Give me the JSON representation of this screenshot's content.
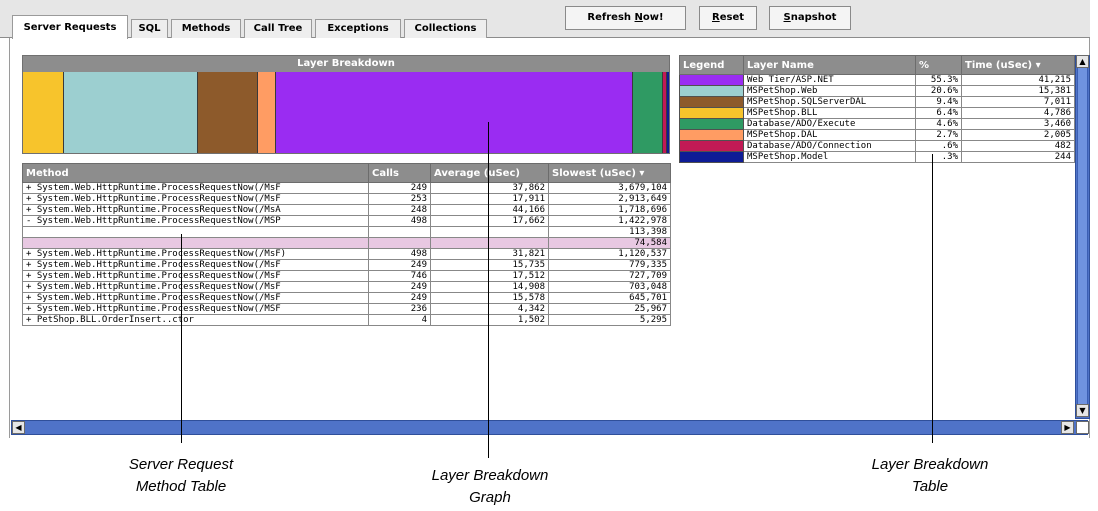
{
  "tabs": [
    {
      "label": "Server Requests",
      "active": true
    },
    {
      "label": "SQL"
    },
    {
      "label": "Methods"
    },
    {
      "label": "Call Tree"
    },
    {
      "label": "Exceptions"
    },
    {
      "label": "Collections"
    }
  ],
  "toolbar": {
    "refresh_prefix": "Refresh ",
    "refresh_ul": "N",
    "refresh_suffix": "ow!",
    "reset_ul": "R",
    "reset_suffix": "eset",
    "snapshot_ul": "S",
    "snapshot_suffix": "napshot"
  },
  "graph": {
    "title": "Layer Breakdown",
    "segments": [
      {
        "color": "#f7c42c",
        "share": 6.4
      },
      {
        "color": "#9ccfd0",
        "share": 20.6
      },
      {
        "color": "#8d5a2b",
        "share": 9.4
      },
      {
        "color": "#ff9c63",
        "share": 2.7
      },
      {
        "color": "#9a2cf2",
        "share": 55.3
      },
      {
        "color": "#2f9a63",
        "share": 4.6
      },
      {
        "color": "#c21a55",
        "share": 0.6
      },
      {
        "color": "#0e1c96",
        "share": 0.3
      }
    ]
  },
  "method_table": {
    "headers": [
      "Method",
      "Calls",
      "Average (uSec)",
      "Slowest (uSec) ▾"
    ],
    "rows": [
      {
        "method": "+ System.Web.HttpRuntime.ProcessRequestNow(/MsF",
        "calls": "249",
        "avg": "37,862",
        "slowest": "3,679,104"
      },
      {
        "method": "+ System.Web.HttpRuntime.ProcessRequestNow(/MsF",
        "calls": "253",
        "avg": "17,911",
        "slowest": "2,913,649"
      },
      {
        "method": "+ System.Web.HttpRuntime.ProcessRequestNow(/MsA",
        "calls": "248",
        "avg": "44,166",
        "slowest": "1,718,696"
      },
      {
        "method": "- System.Web.HttpRuntime.ProcessRequestNow(/MSP",
        "calls": "498",
        "avg": "17,662",
        "slowest": "1,422,978"
      },
      {
        "method": "",
        "calls": "",
        "avg": "",
        "slowest": "113,398",
        "style": "blank"
      },
      {
        "method": "",
        "calls": "",
        "avg": "",
        "slowest": "74,584",
        "style": "shaded"
      },
      {
        "method": "+ System.Web.HttpRuntime.ProcessRequestNow(/MsF)",
        "calls": "498",
        "avg": "31,821",
        "slowest": "1,120,537"
      },
      {
        "method": "+ System.Web.HttpRuntime.ProcessRequestNow(/MsF",
        "calls": "249",
        "avg": "15,735",
        "slowest": "779,335"
      },
      {
        "method": "+ System.Web.HttpRuntime.ProcessRequestNow(/MsF",
        "calls": "746",
        "avg": "17,512",
        "slowest": "727,709"
      },
      {
        "method": "+ System.Web.HttpRuntime.ProcessRequestNow(/MsF",
        "calls": "249",
        "avg": "14,908",
        "slowest": "703,048"
      },
      {
        "method": "+ System.Web.HttpRuntime.ProcessRequestNow(/MsF",
        "calls": "249",
        "avg": "15,578",
        "slowest": "645,701"
      },
      {
        "method": "+ System.Web.HttpRuntime.ProcessRequestNow(/MSF",
        "calls": "236",
        "avg": "4,342",
        "slowest": "25,967"
      },
      {
        "method": "+ PetShop.BLL.OrderInsert..ctor",
        "calls": "4",
        "avg": "1,502",
        "slowest": "5,295"
      }
    ]
  },
  "layer_table": {
    "headers": [
      "Legend",
      "Layer Name",
      "%",
      "Time (uSec) ▾"
    ],
    "rows": [
      {
        "color": "#9a2cf2",
        "name": "Web Tier/ASP.NET",
        "pct": "55.3%",
        "time": "41,215"
      },
      {
        "color": "#9ccfd0",
        "name": "MSPetShop.Web",
        "pct": "20.6%",
        "time": "15,381"
      },
      {
        "color": "#8d5a2b",
        "name": "MSPetShop.SQLServerDAL",
        "pct": "9.4%",
        "time": "7,011"
      },
      {
        "color": "#f7c42c",
        "name": "MSPetShop.BLL",
        "pct": "6.4%",
        "time": "4,786"
      },
      {
        "color": "#2f9a63",
        "name": "Database/ADO/Execute",
        "pct": "4.6%",
        "time": "3,460"
      },
      {
        "color": "#ff9c63",
        "name": "MSPetShop.DAL",
        "pct": "2.7%",
        "time": "2,005"
      },
      {
        "color": "#c21a55",
        "name": "Database/ADO/Connection",
        "pct": ".6%",
        "time": "482"
      },
      {
        "color": "#0e1c96",
        "name": "MSPetShop.Model",
        "pct": ".3%",
        "time": "244"
      }
    ]
  },
  "captions": {
    "method_table": [
      "Server Request",
      "Method Table"
    ],
    "graph": [
      "Layer Breakdown",
      "Graph"
    ],
    "layer_table": [
      "Layer Breakdown",
      "Table"
    ]
  }
}
